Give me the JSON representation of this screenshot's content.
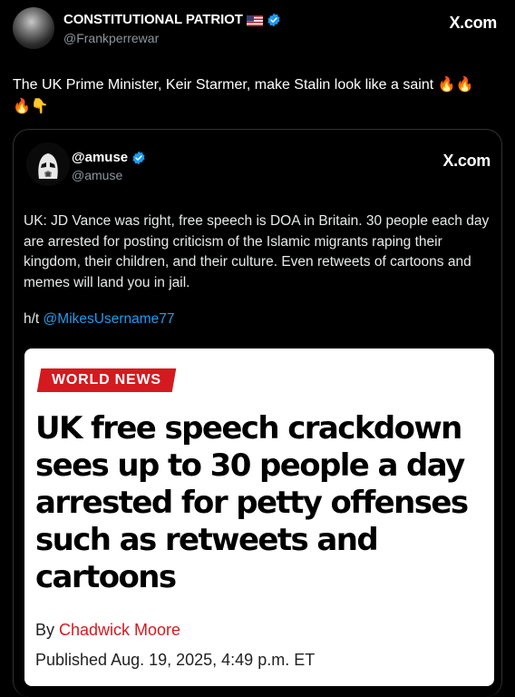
{
  "post": {
    "display_name": "CONSTITUTIONAL PATRIOT",
    "handle": "@Frankperrewar",
    "source_label": "X.com",
    "text": "The UK Prime Minister, Keir Starmer, make Stalin look like a saint 🔥🔥\n🔥👇"
  },
  "quoted": {
    "display_name": "@amuse",
    "handle": "@amuse",
    "source_label": "X.com",
    "text": "UK: JD Vance was right, free speech is DOA in Britain. 30 people each day are arrested for posting criticism of the Islamic migrants raping their kingdom, their children, and their culture. Even retweets of cartoons and memes will land you in jail.",
    "hattip_prefix": "h/t ",
    "hattip_mention": "@MikesUsername77"
  },
  "article": {
    "section_badge": "WORLD NEWS",
    "headline": "UK free speech crackdown sees up to 30 people a day arrested for petty offenses such as retweets and cartoons",
    "byline_prefix": "By ",
    "author": "Chadwick Moore",
    "published": "Published Aug. 19, 2025, 4:49 p.m. ET"
  },
  "colors": {
    "background": "#000000",
    "link_blue": "#1d9bf0",
    "badge_red": "#d41a1f",
    "verified_blue": "#1d9bf0"
  },
  "icons": [
    "avatar",
    "us-flag-icon",
    "verified-badge-icon",
    "stormtrooper-avatar"
  ]
}
